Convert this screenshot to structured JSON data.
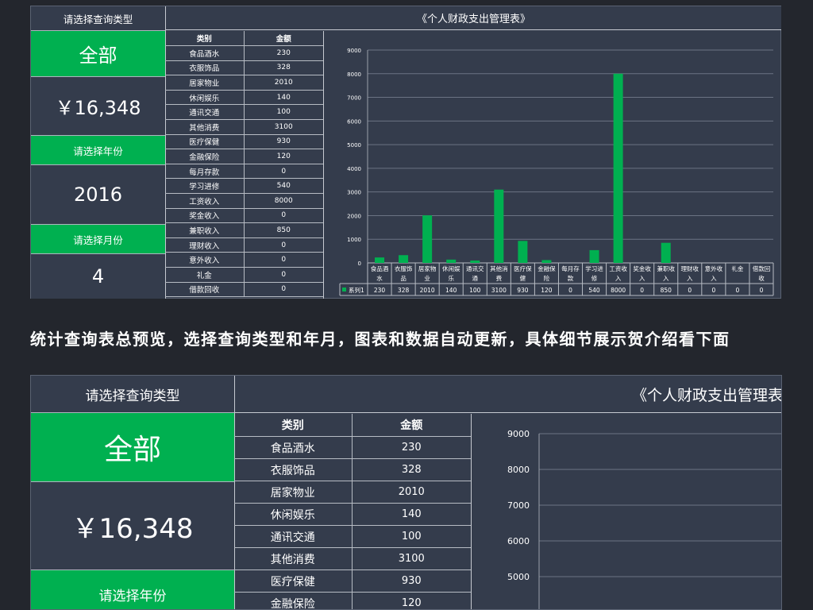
{
  "top": {
    "query_type_label": "请选择查询类型",
    "query_type_value": "全部",
    "total_amount": "￥16,348",
    "year_label": "请选择年份",
    "year_value": "2016",
    "month_label": "请选择月份",
    "month_value": "4",
    "title": "《个人财政支出管理表》",
    "table_headers": [
      "类别",
      "金额"
    ],
    "table_rows": [
      {
        "category": "食品酒水",
        "amount": "230"
      },
      {
        "category": "衣服饰品",
        "amount": "328"
      },
      {
        "category": "居家物业",
        "amount": "2010"
      },
      {
        "category": "休闲娱乐",
        "amount": "140"
      },
      {
        "category": "通讯交通",
        "amount": "100"
      },
      {
        "category": "其他消费",
        "amount": "3100"
      },
      {
        "category": "医疗保健",
        "amount": "930"
      },
      {
        "category": "金融保险",
        "amount": "120"
      },
      {
        "category": "每月存款",
        "amount": "0"
      },
      {
        "category": "学习进修",
        "amount": "540"
      },
      {
        "category": "工资收入",
        "amount": "8000"
      },
      {
        "category": "奖金收入",
        "amount": "0"
      },
      {
        "category": "兼职收入",
        "amount": "850"
      },
      {
        "category": "理财收入",
        "amount": "0"
      },
      {
        "category": "意外收入",
        "amount": "0"
      },
      {
        "category": "礼金",
        "amount": "0"
      },
      {
        "category": "借款回收",
        "amount": "0"
      }
    ]
  },
  "caption": "统计查询表总预览，选择查询类型和年月，图表和数据自动更新，具体细节展示贺介绍看下面",
  "bottom": {
    "query_type_label": "请选择查询类型",
    "query_type_value": "全部",
    "total_amount": "￥16,348",
    "year_label": "请选择年份",
    "title": "《个人财政支出管理表",
    "table_headers": [
      "类别",
      "金额"
    ],
    "table_rows": [
      {
        "category": "食品酒水",
        "amount": "230"
      },
      {
        "category": "衣服饰品",
        "amount": "328"
      },
      {
        "category": "居家物业",
        "amount": "2010"
      },
      {
        "category": "休闲娱乐",
        "amount": "140"
      },
      {
        "category": "通讯交通",
        "amount": "100"
      },
      {
        "category": "其他消费",
        "amount": "3100"
      },
      {
        "category": "医疗保健",
        "amount": "930"
      },
      {
        "category": "金融保险",
        "amount": "120"
      }
    ],
    "y_ticks": [
      "9000",
      "8000",
      "7000",
      "6000",
      "5000"
    ]
  },
  "colors": {
    "green": "#00b050",
    "panel": "#343c4c",
    "page": "#23262d"
  },
  "chart_data": {
    "type": "bar",
    "categories": [
      "食品酒水",
      "衣服饰品",
      "居家物业",
      "休闲娱乐",
      "通讯交通",
      "其他消费",
      "医疗保健",
      "金融保险",
      "每月存款",
      "学习进修",
      "工资收入",
      "奖金收入",
      "兼职收入",
      "理财收入",
      "意外收入",
      "礼金",
      "借款回收"
    ],
    "category_lines": [
      [
        "食品酒",
        "水"
      ],
      [
        "衣服饰",
        "品"
      ],
      [
        "居家物",
        "业"
      ],
      [
        "休闲娱",
        "乐"
      ],
      [
        "通讯交",
        "通"
      ],
      [
        "其他消",
        "费"
      ],
      [
        "医疗保",
        "健"
      ],
      [
        "金融保",
        "险"
      ],
      [
        "每月存",
        "款"
      ],
      [
        "学习进",
        "修"
      ],
      [
        "工资收",
        "入"
      ],
      [
        "奖金收",
        "入"
      ],
      [
        "兼职收",
        "入"
      ],
      [
        "理财收",
        "入"
      ],
      [
        "意外收",
        "入"
      ],
      [
        "礼金",
        ""
      ],
      [
        "借款回",
        "收"
      ]
    ],
    "series": [
      {
        "name": "系列1",
        "values": [
          230,
          328,
          2010,
          140,
          100,
          3100,
          930,
          120,
          0,
          540,
          8000,
          0,
          850,
          0,
          0,
          0,
          0
        ]
      }
    ],
    "ylim": [
      0,
      9000
    ],
    "y_ticks": [
      "0",
      "1000",
      "2000",
      "3000",
      "4000",
      "5000",
      "6000",
      "7000",
      "8000",
      "9000"
    ],
    "grid": true,
    "legend": "data-table"
  }
}
